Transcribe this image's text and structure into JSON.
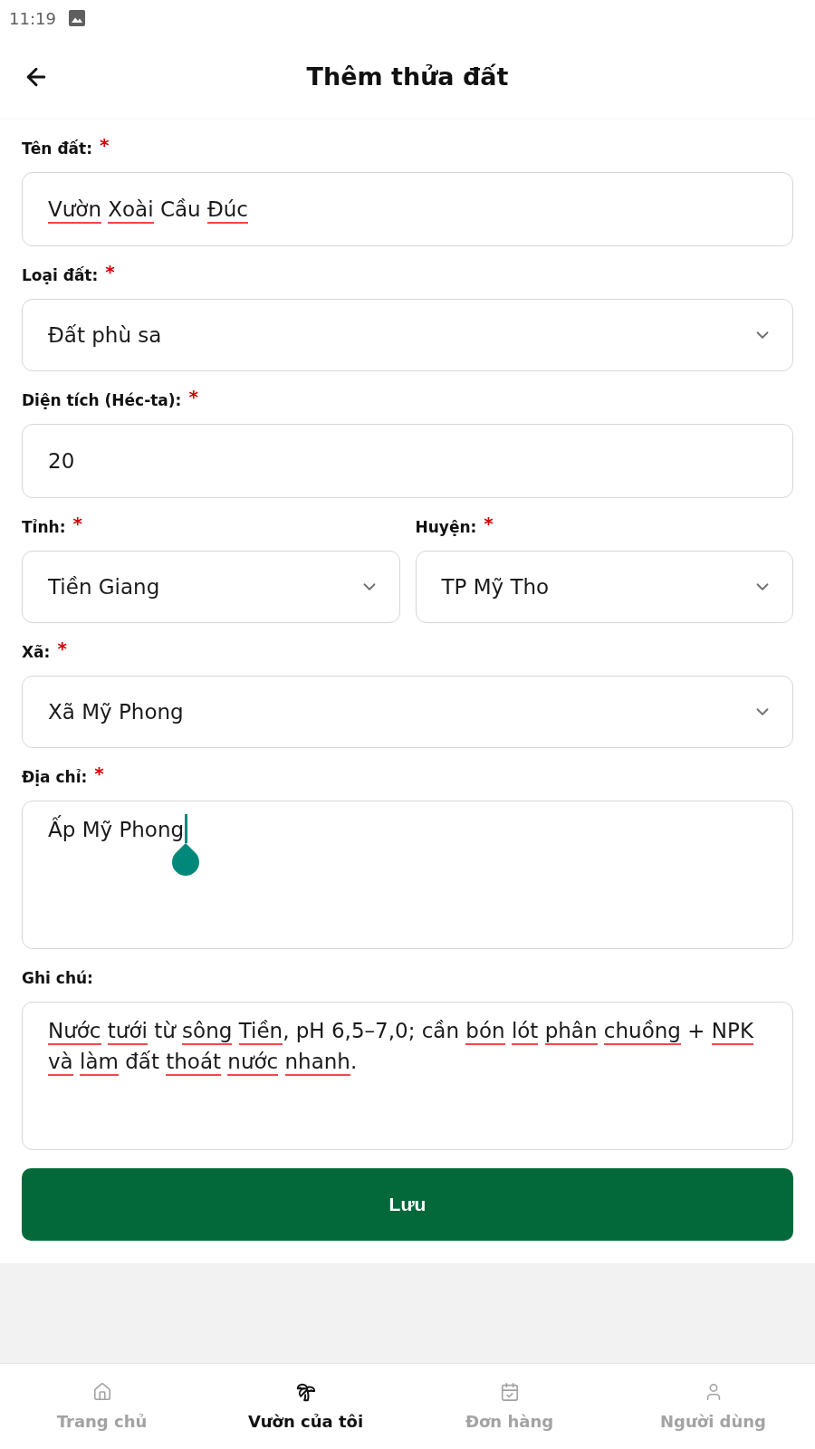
{
  "status_bar": {
    "time": "11:19"
  },
  "header": {
    "title": "Thêm thửa đất"
  },
  "form": {
    "rows": [
      {
        "fields": [
          {
            "kind": "text",
            "label": "Tên đất:",
            "required_mark": "*",
            "value": "Vườn Xoài Cầu Đúc",
            "misspelled_words": [
              true,
              true,
              false,
              true
            ]
          }
        ]
      },
      {
        "fields": [
          {
            "kind": "select",
            "label": "Loại đất:",
            "required_mark": "*",
            "value": "Đất phù sa"
          }
        ]
      },
      {
        "fields": [
          {
            "kind": "text",
            "label": "Diện tích (Héc-ta):",
            "required_mark": "*",
            "value": "20"
          }
        ]
      },
      {
        "fields": [
          {
            "kind": "select",
            "label": "Tỉnh:",
            "required_mark": "*",
            "value": "Tiền Giang"
          },
          {
            "kind": "select",
            "label": "Huyện:",
            "required_mark": "*",
            "value": "TP Mỹ Tho"
          }
        ]
      },
      {
        "fields": [
          {
            "kind": "select",
            "label": "Xã:",
            "required_mark": "*",
            "value": "Xã Mỹ Phong"
          }
        ]
      },
      {
        "fields": [
          {
            "kind": "textarea",
            "label": "Địa chỉ:",
            "required_mark": "*",
            "value": "Ấp Mỹ Phong",
            "cursor": true
          }
        ]
      },
      {
        "fields": [
          {
            "kind": "textarea",
            "label": "Ghi chú:",
            "value": "Nước tưới từ sông Tiền, pH 6,5–7,0; cần bón lót phân chuồng + NPK và làm đất thoát nước nhanh.",
            "misspelled_words": [
              true,
              true,
              false,
              true,
              true,
              false,
              false,
              false,
              true,
              true,
              true,
              true,
              false,
              true,
              true,
              true,
              false,
              true,
              true,
              true
            ]
          }
        ]
      }
    ],
    "save_button": "Lưu"
  },
  "bottom_nav": {
    "items": [
      {
        "label": "Trang chủ",
        "selected": false
      },
      {
        "label": "Vườn của tôi",
        "selected": true
      },
      {
        "label": "Đơn hàng",
        "selected": false
      },
      {
        "label": "Người dùng",
        "selected": false
      }
    ]
  }
}
